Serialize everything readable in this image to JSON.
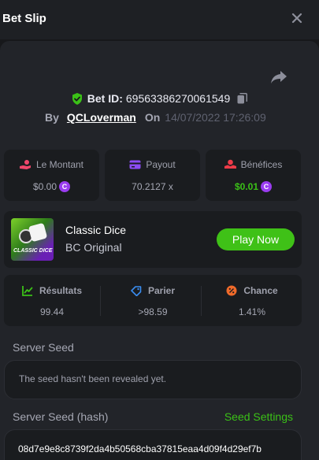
{
  "header": {
    "title": "Bet Slip"
  },
  "bet": {
    "id_label": "Bet ID:",
    "id_value": "69563386270061549",
    "by_label": "By",
    "user": "QCLoverman",
    "on_label": "On",
    "date": "14/07/2022 17:26:09"
  },
  "stats": [
    {
      "label": "Le Montant",
      "value": "$0.00",
      "coin": true,
      "color": "#f0476b"
    },
    {
      "label": "Payout",
      "value": "70.2127 x",
      "coin": false,
      "color": "#8c4cf4"
    },
    {
      "label": "Bénéfices",
      "value": "$0.01",
      "coin": true,
      "color": "#ee3b48"
    }
  ],
  "game": {
    "thumb_text": "CLASSIC DICE",
    "name": "Classic Dice",
    "subtitle": "BC Original",
    "play_label": "Play Now"
  },
  "results": [
    {
      "label": "Résultats",
      "value": "99.44",
      "color": "#3bc117"
    },
    {
      "label": "Parier",
      "value": ">98.59",
      "color": "#3a8df0"
    },
    {
      "label": "Chance",
      "value": "1.41%",
      "color": "#f06a2a"
    }
  ],
  "seeds": {
    "server_seed_label": "Server Seed",
    "server_seed_value": "The seed hasn't been revealed yet.",
    "hash_label": "Server Seed (hash)",
    "settings_link": "Seed Settings",
    "hash_value": "08d7e9e8c8739f2da4b50568cba37815eaa4d09f4d29ef7b"
  }
}
